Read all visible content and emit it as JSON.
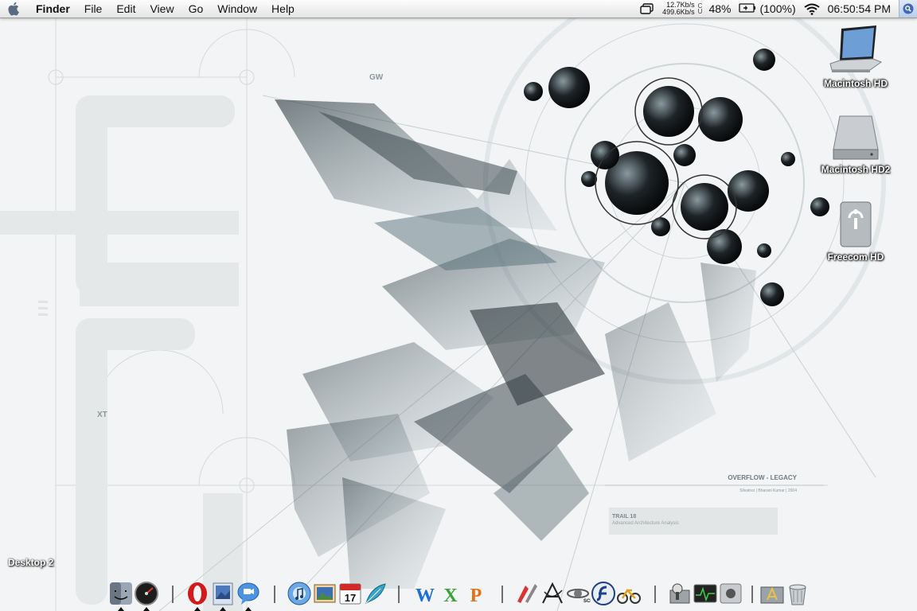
{
  "menubar": {
    "app_name": "Finder",
    "menus": [
      "File",
      "Edit",
      "View",
      "Go",
      "Window",
      "Help"
    ],
    "net_up": "12.7Kb/s",
    "net_down": "499.6Kb/s",
    "gauge_labels": [
      "C",
      "U"
    ],
    "cpu_percent": "48%",
    "battery": "(100%)",
    "clock": "06:50:54 PM"
  },
  "desktop_icons": [
    {
      "label": "Macintosh HD",
      "icon": "laptop-icon"
    },
    {
      "label": "Macintosh HD2",
      "icon": "hard-drive-icon"
    },
    {
      "label": "Freecom HD",
      "icon": "firewire-drive-icon"
    }
  ],
  "space_label": "Desktop 2",
  "wallpaper_text": {
    "top_tag": "GW",
    "side_tag": "XT",
    "legend_title": "OVERFLOW - LEGACY",
    "legend_credit": "Silvatrez | Bharani Kumar | 2004",
    "box_title": "TRAIL 18",
    "box_subtitle": "Advanced Architecture Analysis"
  },
  "dock": {
    "apps": [
      {
        "name": "finder",
        "icon": "finder-icon",
        "running": true
      },
      {
        "name": "dashboard",
        "icon": "dashboard-icon",
        "running": true
      },
      {
        "name": "opera",
        "icon": "opera-icon",
        "running": true
      },
      {
        "name": "preview",
        "icon": "preview-icon",
        "running": true
      },
      {
        "name": "ichat",
        "icon": "ichat-icon",
        "running": true
      },
      {
        "name": "itunes",
        "icon": "itunes-icon",
        "running": false
      },
      {
        "name": "iphoto",
        "icon": "iphoto-icon",
        "running": false
      },
      {
        "name": "ical",
        "icon": "ical-icon",
        "running": false
      },
      {
        "name": "textedit",
        "icon": "feather-icon",
        "running": false
      },
      {
        "name": "word",
        "icon": "word-icon",
        "running": false
      },
      {
        "name": "excel",
        "icon": "excel-icon",
        "running": false
      },
      {
        "name": "powerpoint",
        "icon": "powerpoint-icon",
        "running": false
      },
      {
        "name": "sketch",
        "icon": "paint-icon",
        "running": false
      },
      {
        "name": "acrobat",
        "icon": "acrobat-icon",
        "running": false
      },
      {
        "name": "scp",
        "icon": "scp-icon",
        "running": false
      },
      {
        "name": "flash",
        "icon": "flash-icon",
        "running": false
      },
      {
        "name": "utility",
        "icon": "bike-icon",
        "running": false
      },
      {
        "name": "disk-utility",
        "icon": "disk-utility-icon",
        "running": false
      },
      {
        "name": "activity-monitor",
        "icon": "activity-monitor-icon",
        "running": false
      },
      {
        "name": "system-prefs",
        "icon": "apple-prefs-icon",
        "running": false
      },
      {
        "name": "applications",
        "icon": "applications-folder-icon",
        "running": false
      },
      {
        "name": "trash",
        "icon": "trash-icon",
        "running": false
      }
    ],
    "date_day": "17"
  },
  "colors": {
    "menubar_top": "#fdfdfd",
    "menubar_bottom": "#e4e4e4",
    "wallpaper_bg": "#f3f4f5",
    "wallpaper_ink": "#2a3438",
    "wallpaper_teal": "#5d7d88"
  }
}
